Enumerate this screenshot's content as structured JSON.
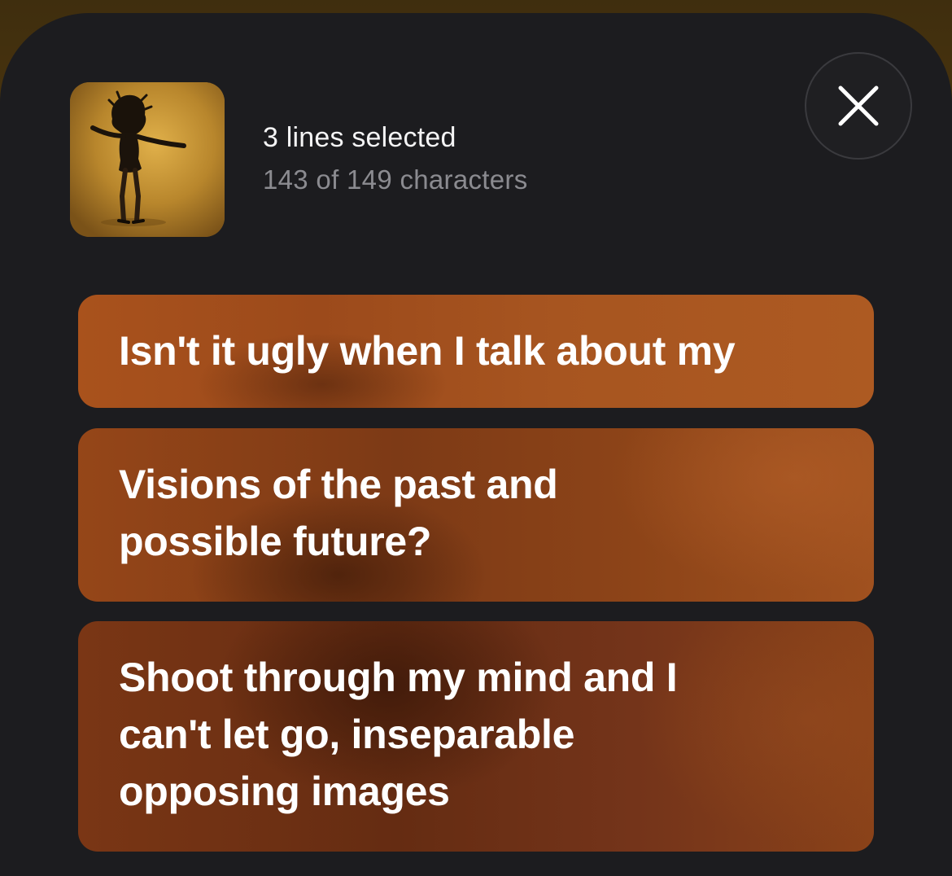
{
  "header": {
    "title": "3 lines selected",
    "subtitle": "143 of 149 characters",
    "artwork_icon": "album-artwork",
    "close_icon": "close-icon"
  },
  "lyrics": [
    {
      "lines": [
        "Isn't it ugly when I talk about my"
      ]
    },
    {
      "lines": [
        "Visions of the past and",
        "possible future?"
      ]
    },
    {
      "lines": [
        "Shoot through my mind and I",
        "can't let go, inseparable",
        "opposing images"
      ]
    }
  ],
  "colors": {
    "sheet": "#1c1c1f",
    "card_accent": "#a9521c",
    "subtitle": "#8b8b90"
  }
}
